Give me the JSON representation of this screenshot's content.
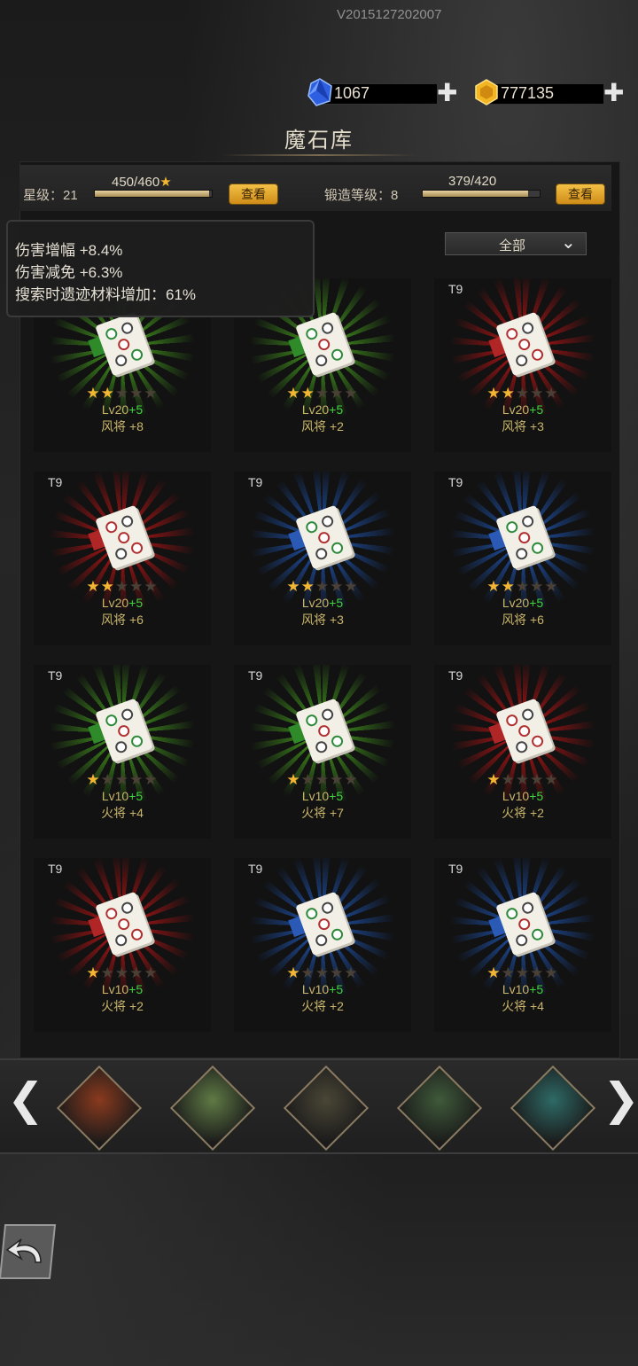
{
  "header": {
    "version": "V2015127202007",
    "gems": "1067",
    "gold": "777135",
    "plus": "✚",
    "title": "魔石库"
  },
  "stats": {
    "star_label": "星级：21",
    "star_progress": "450/460",
    "star_fraction": 0.978,
    "star_view": "查看",
    "forge_label": "锻造等级：8",
    "forge_progress": "379/420",
    "forge_fraction": 0.902,
    "forge_view": "查看"
  },
  "filter": {
    "selected": "全部"
  },
  "tooltip": {
    "line1": "伤害增幅 +8.4%",
    "line2": "伤害减免 +6.3%",
    "line3": "搜索时遗迹材料增加：61%"
  },
  "items": [
    {
      "tier": "",
      "color": "green",
      "stars": 2,
      "lv": "Lv20",
      "bonus": "+5",
      "effect": "风将 +8"
    },
    {
      "tier": "",
      "color": "green",
      "stars": 2,
      "lv": "Lv20",
      "bonus": "+5",
      "effect": "风将 +2"
    },
    {
      "tier": "T9",
      "color": "red",
      "stars": 2,
      "lv": "Lv20",
      "bonus": "+5",
      "effect": "风将 +3"
    },
    {
      "tier": "T9",
      "color": "red",
      "stars": 2,
      "lv": "Lv20",
      "bonus": "+5",
      "effect": "风将 +6"
    },
    {
      "tier": "T9",
      "color": "blue",
      "stars": 2,
      "lv": "Lv20",
      "bonus": "+5",
      "effect": "风将 +3"
    },
    {
      "tier": "T9",
      "color": "blue",
      "stars": 2,
      "lv": "Lv20",
      "bonus": "+5",
      "effect": "风将 +6"
    },
    {
      "tier": "T9",
      "color": "green",
      "stars": 1,
      "lv": "Lv10",
      "bonus": "+5",
      "effect": "火将 +4"
    },
    {
      "tier": "T9",
      "color": "green",
      "stars": 1,
      "lv": "Lv10",
      "bonus": "+5",
      "effect": "火将 +7"
    },
    {
      "tier": "T9",
      "color": "red",
      "stars": 1,
      "lv": "Lv10",
      "bonus": "+5",
      "effect": "火将 +2"
    },
    {
      "tier": "T9",
      "color": "red",
      "stars": 1,
      "lv": "Lv10",
      "bonus": "+5",
      "effect": "火将 +2"
    },
    {
      "tier": "T9",
      "color": "blue",
      "stars": 1,
      "lv": "Lv10",
      "bonus": "+5",
      "effect": "火将 +2"
    },
    {
      "tier": "T9",
      "color": "blue",
      "stars": 1,
      "lv": "Lv10",
      "bonus": "+5",
      "effect": "火将 +4"
    }
  ],
  "zones": [
    {
      "name": "volcano-zone",
      "color": "#8a3a1e"
    },
    {
      "name": "mountain-zone",
      "color": "#5f7a45"
    },
    {
      "name": "swamp-zone",
      "color": "#4a4636"
    },
    {
      "name": "forest-zone",
      "color": "#3f5a3a"
    },
    {
      "name": "temple-zone",
      "color": "#2e6a66"
    }
  ],
  "nav": {
    "prev": "❮",
    "next": "❯"
  }
}
